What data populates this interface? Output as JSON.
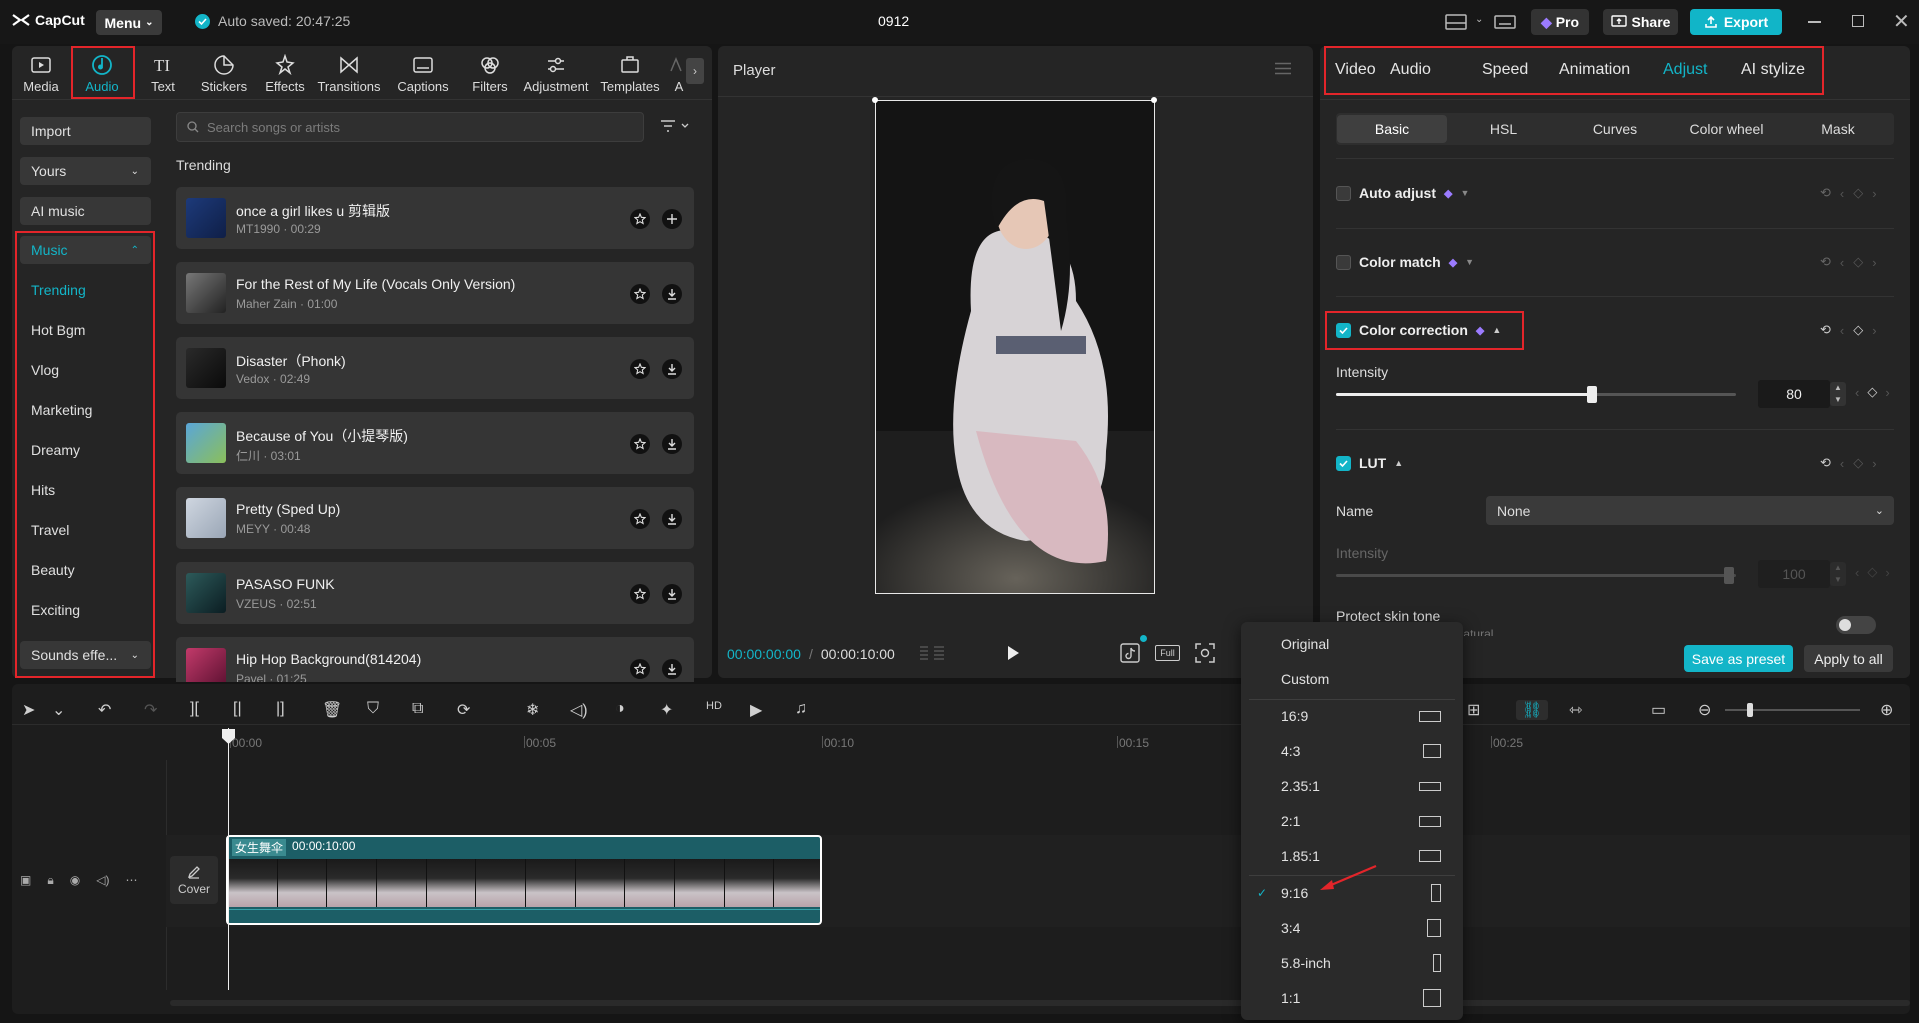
{
  "app": {
    "logo": "CapCut",
    "menu_label": "Menu",
    "autosave_text": "Auto saved: 20:47:25",
    "project_name": "0912",
    "pro_label": "Pro",
    "share_label": "Share",
    "export_label": "Export"
  },
  "toolbar_tabs": [
    {
      "label": "Media",
      "icon": "media-icon"
    },
    {
      "label": "Audio",
      "icon": "audio-icon",
      "active": true
    },
    {
      "label": "Text",
      "icon": "text-icon"
    },
    {
      "label": "Stickers",
      "icon": "sticker-icon"
    },
    {
      "label": "Effects",
      "icon": "effects-icon"
    },
    {
      "label": "Transitions",
      "icon": "transitions-icon"
    },
    {
      "label": "Captions",
      "icon": "captions-icon"
    },
    {
      "label": "Filters",
      "icon": "filters-icon"
    },
    {
      "label": "Adjustment",
      "icon": "adjustment-icon"
    },
    {
      "label": "Templates",
      "icon": "templates-icon"
    },
    {
      "label": "A",
      "icon": "more-icon"
    }
  ],
  "sidebar": {
    "import_label": "Import",
    "yours_label": "Yours",
    "ai_music_label": "AI music",
    "music_label": "Music",
    "categories": [
      "Trending",
      "Hot Bgm",
      "Vlog",
      "Marketing",
      "Dreamy",
      "Hits",
      "Travel",
      "Beauty",
      "Exciting"
    ],
    "sounds_label": "Sounds effe..."
  },
  "library": {
    "search_placeholder": "Search songs or artists",
    "section_title": "Trending",
    "songs": [
      {
        "title": "once a girl likes u 剪辑版",
        "meta": "MT1990 · 00:29",
        "action": "add"
      },
      {
        "title": "For the Rest of My Life (Vocals Only Version)",
        "meta": "Maher Zain · 01:00",
        "action": "download"
      },
      {
        "title": "Disaster（Phonk)",
        "meta": "Vedox · 02:49",
        "action": "download"
      },
      {
        "title": "Because of You（小提琴版)",
        "meta": "仁川 · 03:01",
        "action": "download"
      },
      {
        "title": "Pretty (Sped Up)",
        "meta": "MEYY · 00:48",
        "action": "download"
      },
      {
        "title": "PASASO FUNK",
        "meta": "VZEUS · 02:51",
        "action": "download"
      },
      {
        "title": "Hip Hop Background(814204)",
        "meta": "Pavel · 01:25",
        "action": "download"
      }
    ]
  },
  "player": {
    "title": "Player",
    "time_current": "00:00:00:00",
    "time_separator": "/",
    "time_total": "00:00:10:00",
    "full_label": "Full"
  },
  "inspector": {
    "tabs": [
      "Video",
      "Audio",
      "Speed",
      "Animation",
      "Adjust",
      "AI stylize"
    ],
    "active_tab": "Adjust",
    "subtabs": [
      "Basic",
      "HSL",
      "Curves",
      "Color wheel",
      "Mask"
    ],
    "auto_adjust": "Auto adjust",
    "color_match": "Color match",
    "color_correction": "Color correction",
    "intensity_label": "Intensity",
    "intensity_value": "80",
    "intensity_fraction": 0.8,
    "lut_label": "LUT",
    "name_label": "Name",
    "name_value": "None",
    "lut_intensity_label": "Intensity",
    "lut_intensity_value": "100",
    "protect_skin": "Protect skin tone",
    "protect_skin_hint": "Make skin tones more natural",
    "save_preset": "Save as preset",
    "apply_all": "Apply to all"
  },
  "ratio_menu": {
    "options": [
      {
        "label": "Original"
      },
      {
        "label": "Custom"
      },
      {
        "label": "16:9"
      },
      {
        "label": "4:3"
      },
      {
        "label": "2.35:1"
      },
      {
        "label": "2:1"
      },
      {
        "label": "1.85:1"
      },
      {
        "label": "9:16",
        "selected": true
      },
      {
        "label": "3:4"
      },
      {
        "label": "5.8-inch"
      },
      {
        "label": "1:1"
      }
    ]
  },
  "timeline": {
    "ruler": [
      "00:00",
      "00:05",
      "00:10",
      "00:15",
      "00:25"
    ],
    "clip_name": "女生舞伞",
    "clip_duration": "00:00:10:00",
    "cover_label": "Cover"
  },
  "colors": {
    "accent": "#13b5c8",
    "highlight": "#e3252a",
    "panel": "#252525"
  }
}
